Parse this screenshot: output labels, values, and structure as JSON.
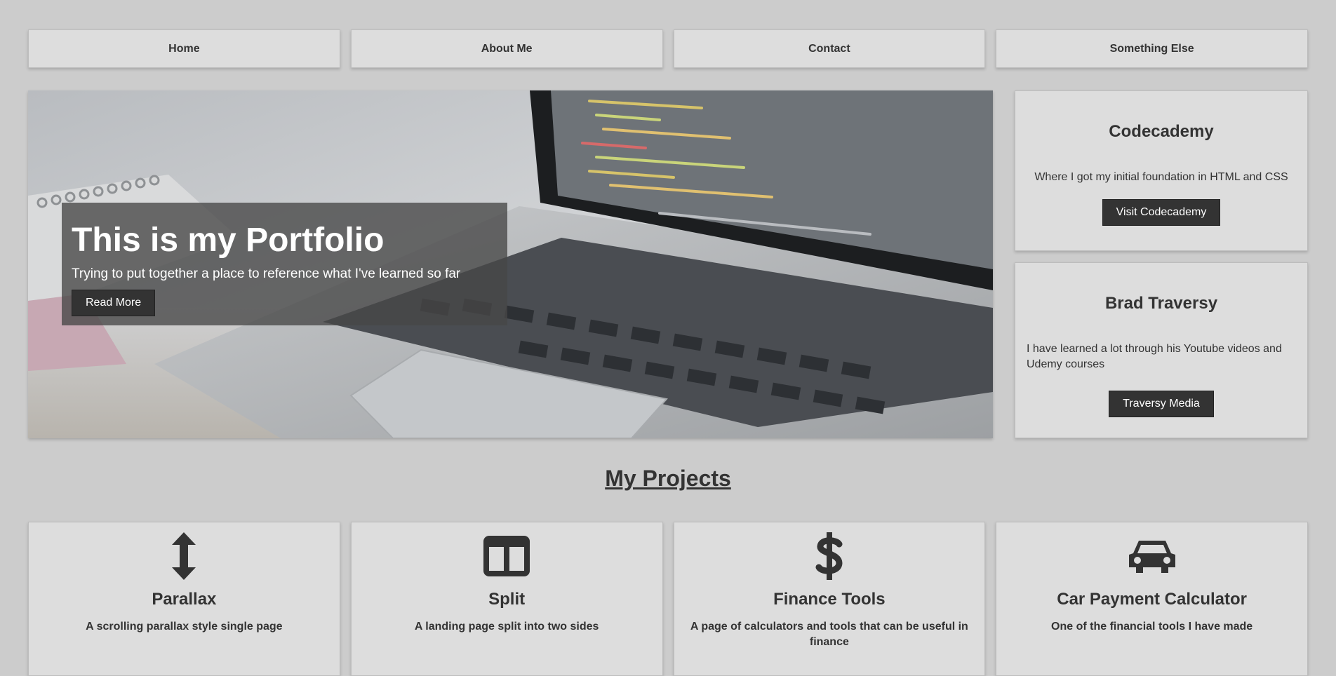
{
  "nav": {
    "items": [
      "Home",
      "About Me",
      "Contact",
      "Something Else"
    ]
  },
  "showcase": {
    "heading": "This is my Portfolio",
    "subheading": "Trying to put together a place to reference what I've learned so far",
    "button_label": "Read More",
    "image": "laptop-with-code-on-desk"
  },
  "side_cards": [
    {
      "title": "Codecademy",
      "text": "Where I got my initial foundation in HTML and CSS",
      "button_label": "Visit Codecademy"
    },
    {
      "title": "Brad Traversy",
      "text": "I have learned a lot through his Youtube videos and Udemy courses",
      "button_label": "Traversy Media"
    }
  ],
  "projects_title": "My Projects",
  "projects": [
    {
      "icon": "arrows-vertical-icon",
      "title": "Parallax",
      "text": "A scrolling parallax style single page"
    },
    {
      "icon": "columns-icon",
      "title": "Split",
      "text": "A landing page split into two sides"
    },
    {
      "icon": "dollar-icon",
      "title": "Finance Tools",
      "text": "A page of calculators and tools that can be useful in finance"
    },
    {
      "icon": "car-icon",
      "title": "Car Payment Calculator",
      "text": "One of the financial tools I have made"
    }
  ],
  "colors": {
    "background": "#cccccc",
    "card": "#dddddd",
    "button": "#333333",
    "text": "#333333"
  }
}
